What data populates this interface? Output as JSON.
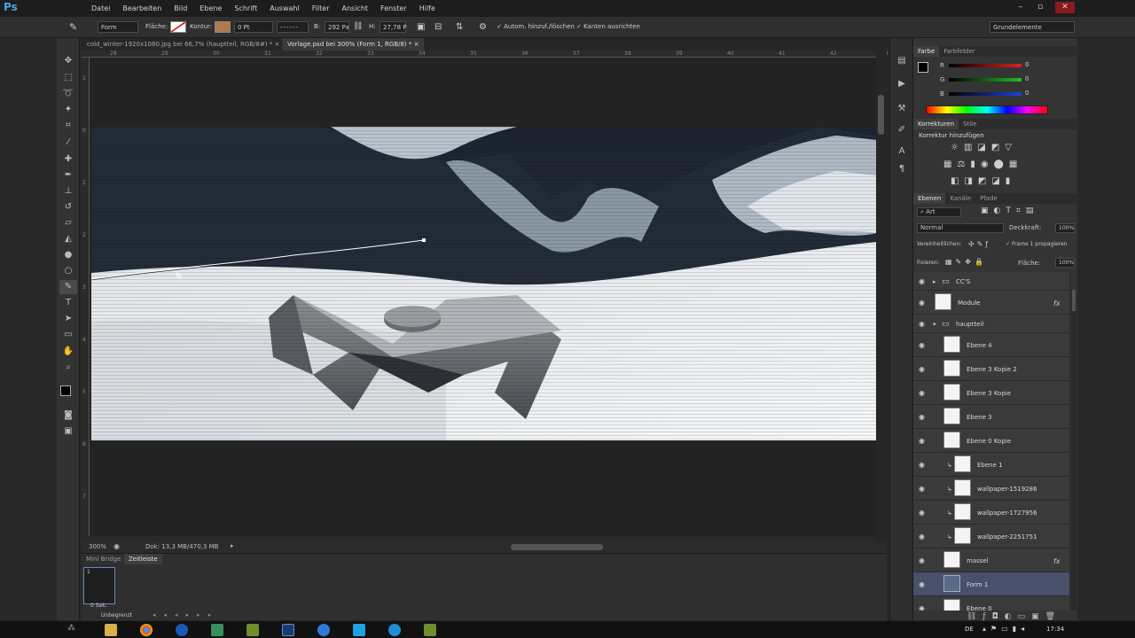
{
  "app": {
    "logo": "Ps"
  },
  "menu": [
    "Datei",
    "Bearbeiten",
    "Bild",
    "Ebene",
    "Schrift",
    "Auswahl",
    "Filter",
    "Ansicht",
    "Fenster",
    "Hilfe"
  ],
  "window_controls": {
    "minimize_icon": "minimize-icon",
    "maximize_icon": "maximize-icon",
    "close_icon": "close-icon"
  },
  "options": {
    "mode": "Form",
    "fill_label": "Fläche:",
    "stroke_label": "Kontur:",
    "stroke_width": "0 Pt",
    "width_label": "B:",
    "width_value": "292 Px",
    "height_label": "H:",
    "height_value": "27,78 P",
    "auto_add_label": "Autom. hinzuf./löschen",
    "align_edges_label": "Kanten ausrichten",
    "workspace": "Grundelemente"
  },
  "tabs": [
    {
      "label": "cold_winter-1920x1080.jpg bei 66,7% (hauptteil, RGB/8#) *",
      "active": false
    },
    {
      "label": "Vorlage.psd bei 300% (Form 1, RGB/8) *",
      "active": true
    }
  ],
  "ruler_top": [
    "28",
    "29",
    "30",
    "31",
    "32",
    "33",
    "34",
    "35",
    "36",
    "37",
    "38",
    "39",
    "40",
    "41",
    "42",
    "43",
    "44",
    "45",
    "46"
  ],
  "ruler_left": [
    "1",
    "0",
    "1",
    "2",
    "3",
    "4",
    "5",
    "6",
    "7"
  ],
  "status": {
    "zoom": "300%",
    "doc": "Dok: 13,3 MB/470,3 MB"
  },
  "bottom": {
    "tabs": [
      "Mini Bridge",
      "Zeitleiste"
    ],
    "frame_number": "1",
    "frame_delay": "0 Sek.",
    "loop": "Unbegrenzt"
  },
  "color_panel": {
    "tabs": [
      "Farbe",
      "Farbfelder"
    ],
    "channels": [
      {
        "label": "R",
        "value": "0",
        "color": "#e02020"
      },
      {
        "label": "G",
        "value": "0",
        "color": "#20c020"
      },
      {
        "label": "B",
        "value": "0",
        "color": "#2040e0"
      }
    ]
  },
  "adjust_panel": {
    "tabs": [
      "Korrekturen",
      "Stile"
    ],
    "title": "Korrektur hinzufügen"
  },
  "layers_panel": {
    "tabs": [
      "Ebenen",
      "Kanäle",
      "Pfade"
    ],
    "filter": "Art",
    "blend_mode": "Normal",
    "opacity_label": "Deckkraft:",
    "opacity_value": "100%",
    "unify_label": "Vereinheitlichen:",
    "propagate_label": "Frame 1 propagieren",
    "lock_label": "Fixieren:",
    "fill_label": "Fläche:",
    "fill_value": "100%",
    "layers": [
      {
        "name": "CC'S",
        "type": "group",
        "indent": 0,
        "fx": false,
        "selected": false,
        "closed": true
      },
      {
        "name": "Module",
        "type": "layer",
        "indent": 0,
        "fx": true,
        "selected": false
      },
      {
        "name": "hauptteil",
        "type": "group",
        "indent": 0,
        "fx": false,
        "selected": false
      },
      {
        "name": "Ebene 4",
        "type": "layer",
        "indent": 1,
        "fx": false,
        "selected": false
      },
      {
        "name": "Ebene 3 Kopie 2",
        "type": "layer",
        "indent": 1,
        "fx": false,
        "selected": false
      },
      {
        "name": "Ebene 3 Kopie",
        "type": "layer",
        "indent": 1,
        "fx": false,
        "selected": false
      },
      {
        "name": "Ebene 3",
        "type": "layer",
        "indent": 1,
        "fx": false,
        "selected": false
      },
      {
        "name": "Ebene 0 Kopie",
        "type": "layer",
        "indent": 1,
        "fx": false,
        "selected": false
      },
      {
        "name": "Ebene 1",
        "type": "clip",
        "indent": 2,
        "fx": false,
        "selected": false
      },
      {
        "name": "wallpaper-1519286",
        "type": "clip",
        "indent": 2,
        "fx": false,
        "selected": false
      },
      {
        "name": "wallpaper-1727956",
        "type": "clip",
        "indent": 2,
        "fx": false,
        "selected": false
      },
      {
        "name": "wallpaper-2251751",
        "type": "clip",
        "indent": 2,
        "fx": false,
        "selected": false
      },
      {
        "name": "massel",
        "type": "layer",
        "indent": 1,
        "fx": true,
        "selected": false
      },
      {
        "name": "Form 1",
        "type": "shape",
        "indent": 1,
        "fx": false,
        "selected": true
      },
      {
        "name": "Ebene 0",
        "type": "layer",
        "indent": 1,
        "fx": false,
        "selected": false
      }
    ]
  },
  "taskbar": {
    "language": "DE",
    "time": "17:34"
  }
}
